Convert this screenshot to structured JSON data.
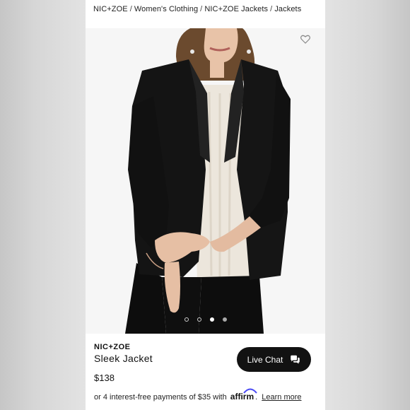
{
  "breadcrumb": {
    "items": [
      "NIC+ZOE",
      "Women's Clothing",
      "NIC+ZOE Jackets",
      "Jackets"
    ],
    "separator": "/"
  },
  "product": {
    "brand": "NIC+ZOE",
    "name": "Sleek Jacket",
    "price": "$138",
    "image_alt": "Woman wearing black jacket over cream knit sweater and black pants",
    "favorite_icon": "heart-outline-icon",
    "image_count": 4,
    "active_image_index": 2
  },
  "payment": {
    "prefix": "or 4 interest-free payments of $35 with",
    "provider": "affirm",
    "period": ".",
    "link_label": "Learn more"
  },
  "chat": {
    "label": "Live Chat",
    "icon": "chat-bubbles-icon"
  },
  "colors": {
    "button_bg": "#121212",
    "text": "#111111",
    "page_bg": "#ffffff",
    "side_bg": "#d4d4d4"
  }
}
